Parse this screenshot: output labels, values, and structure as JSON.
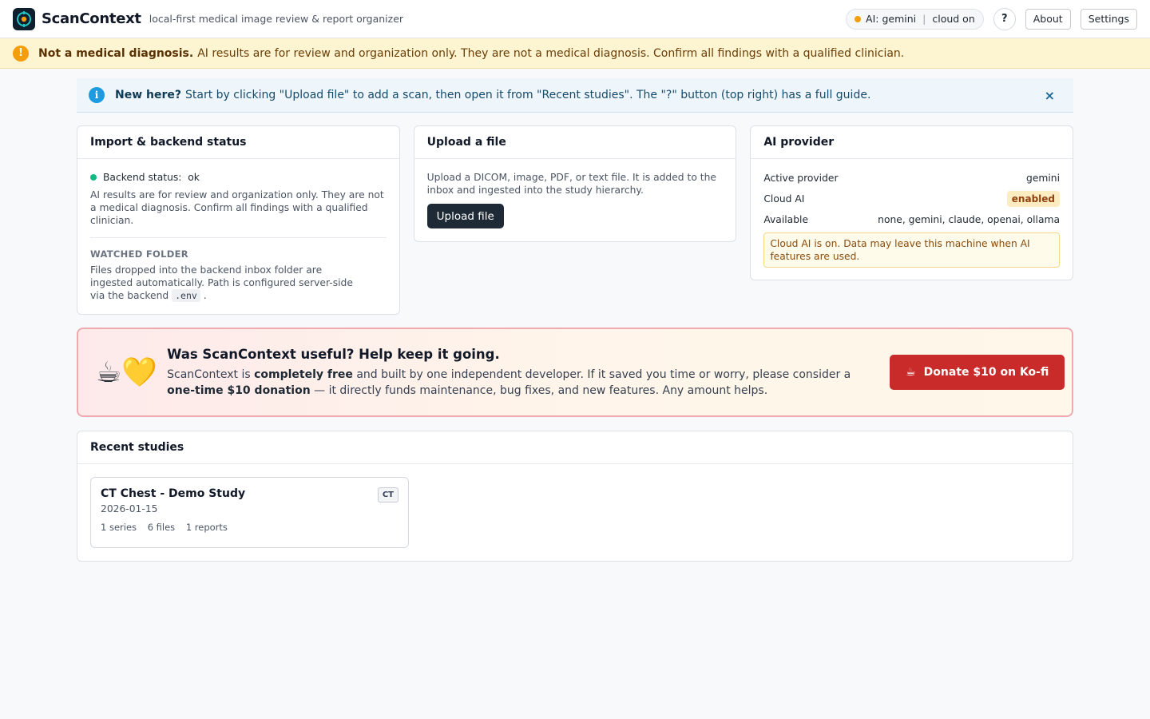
{
  "header": {
    "app_name": "ScanContext",
    "tagline": "local-first medical image review & report organizer",
    "ai_pill": {
      "prefix": "AI:",
      "provider": "gemini",
      "separator": "|",
      "cloud": "cloud on"
    },
    "help_label": "?",
    "about_label": "About",
    "settings_label": "Settings"
  },
  "disclaimer": {
    "title": "Not a medical diagnosis.",
    "text": "AI results are for review and organization only. They are not a medical diagnosis. Confirm all findings with a qualified clinician.",
    "icon": "!"
  },
  "info_banner": {
    "title": "New here?",
    "text": "Start by clicking \"Upload file\" to add a scan, then open it from \"Recent studies\". The \"?\" button (top right) has a full guide.",
    "icon": "i",
    "close": "×"
  },
  "import_card": {
    "title": "Import & backend status",
    "status_label": "Backend status:",
    "status_value": "ok",
    "note": "AI results are for review and organization only. They are not a medical diagnosis. Confirm all findings with a qualified clinician.",
    "watched_label": "WATCHED FOLDER",
    "watched_text": "Files dropped into the backend inbox folder are ingested automatically. Path is configured server-side via the backend",
    "env_code": ".env",
    "period": "."
  },
  "upload_card": {
    "title": "Upload a file",
    "text": "Upload a DICOM, image, PDF, or text file. It is added to the inbox and ingested into the study hierarchy.",
    "button": "Upload file"
  },
  "ai_card": {
    "title": "AI provider",
    "active_label": "Active provider",
    "active_value": "gemini",
    "cloud_label": "Cloud AI",
    "cloud_value": "enabled",
    "available_label": "Available",
    "available_value": "none, gemini, claude, openai, ollama",
    "warning": "Cloud AI is on. Data may leave this machine when AI features are used."
  },
  "donate": {
    "emoji": "☕💛",
    "title": "Was ScanContext useful? Help keep it going.",
    "body_1": "ScanContext is",
    "body_bold_1": "completely free",
    "body_2": "and built by one independent developer. If it saved you time or worry, please consider a",
    "body_bold_2": "one-time $10 donation",
    "body_3": "— it directly funds maintenance, bug fixes, and new features. Any amount helps.",
    "button_icon": "☕",
    "button": "Donate $10 on Ko-fi"
  },
  "recent": {
    "title": "Recent studies",
    "studies": [
      {
        "title": "CT Chest - Demo Study",
        "date": "2026-01-15",
        "modality": "CT",
        "series": "1 series",
        "files": "6 files",
        "reports": "1 reports"
      }
    ]
  },
  "colors": {
    "accent_dark": "#1f2a37",
    "warning": "#f59e0b",
    "ok": "#10b981",
    "info": "#1e9be0",
    "donate": "#c92a2a"
  }
}
